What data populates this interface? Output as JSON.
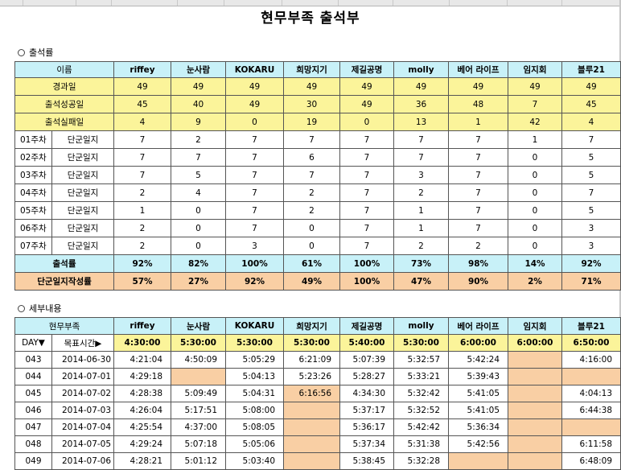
{
  "title": "현무부족 출석부",
  "summary": {
    "heading": "출석률",
    "name_label": "이름",
    "members": [
      "riffey",
      "눈사람",
      "KOKARU",
      "희망지기",
      "제길공명",
      "molly",
      "베어 라이프",
      "임지회",
      "블루21"
    ],
    "elapsed": {
      "label": "경과일",
      "values": [
        "49",
        "49",
        "49",
        "49",
        "49",
        "49",
        "49",
        "49",
        "49"
      ]
    },
    "success": {
      "label": "출석성공일",
      "values": [
        "45",
        "40",
        "49",
        "30",
        "49",
        "36",
        "48",
        "7",
        "45"
      ]
    },
    "fail": {
      "label": "출석실패일",
      "values": [
        "4",
        "9",
        "0",
        "19",
        "0",
        "13",
        "1",
        "42",
        "4"
      ]
    },
    "weeks": [
      {
        "week": "01주차",
        "label": "단군일지",
        "values": [
          "7",
          "2",
          "7",
          "7",
          "7",
          "7",
          "7",
          "1",
          "7"
        ]
      },
      {
        "week": "02주차",
        "label": "단군일지",
        "values": [
          "7",
          "7",
          "7",
          "6",
          "7",
          "7",
          "7",
          "0",
          "5"
        ]
      },
      {
        "week": "03주차",
        "label": "단군일지",
        "values": [
          "7",
          "5",
          "7",
          "7",
          "7",
          "3",
          "7",
          "0",
          "5"
        ]
      },
      {
        "week": "04주차",
        "label": "단군일지",
        "values": [
          "2",
          "4",
          "7",
          "2",
          "7",
          "2",
          "7",
          "0",
          "7"
        ]
      },
      {
        "week": "05주차",
        "label": "단군일지",
        "values": [
          "1",
          "0",
          "7",
          "2",
          "7",
          "1",
          "7",
          "0",
          "5"
        ]
      },
      {
        "week": "06주차",
        "label": "단군일지",
        "values": [
          "2",
          "0",
          "7",
          "0",
          "7",
          "1",
          "7",
          "0",
          "3"
        ]
      },
      {
        "week": "07주차",
        "label": "단군일지",
        "values": [
          "2",
          "0",
          "3",
          "0",
          "7",
          "2",
          "2",
          "0",
          "3"
        ]
      }
    ],
    "rate": {
      "label": "출석률",
      "values": [
        "92%",
        "82%",
        "100%",
        "61%",
        "100%",
        "73%",
        "98%",
        "14%",
        "92%"
      ]
    },
    "journal_rate": {
      "label": "단군일지작성률",
      "values": [
        "57%",
        "27%",
        "92%",
        "49%",
        "100%",
        "47%",
        "90%",
        "2%",
        "71%"
      ]
    }
  },
  "details": {
    "heading": "세부내용",
    "tribe_label": "현무부족",
    "day_label": "DAY▼",
    "target_label": "목표시간▶",
    "targets": [
      "4:30:00",
      "5:30:00",
      "5:30:00",
      "5:30:00",
      "5:40:00",
      "5:30:00",
      "6:00:00",
      "6:00:00",
      "6:50:00"
    ],
    "rows": [
      {
        "day": "043",
        "date": "2014-06-30",
        "times": [
          "4:21:04",
          "4:50:09",
          "5:05:29",
          "6:21:09",
          "5:07:39",
          "5:32:57",
          "5:42:24",
          "",
          "4:16:00"
        ]
      },
      {
        "day": "044",
        "date": "2014-07-01",
        "times": [
          "4:29:18",
          "",
          "5:04:13",
          "5:23:26",
          "5:28:27",
          "5:33:21",
          "5:39:43",
          "",
          ""
        ]
      },
      {
        "day": "045",
        "date": "2014-07-02",
        "times": [
          "4:28:38",
          "5:09:49",
          "5:04:31",
          "6:16:56",
          "4:34:30",
          "5:32:42",
          "5:41:05",
          "",
          "4:04:13"
        ]
      },
      {
        "day": "046",
        "date": "2014-07-03",
        "times": [
          "4:26:04",
          "5:17:51",
          "5:08:00",
          "",
          "5:37:17",
          "5:32:52",
          "5:41:05",
          "",
          "6:44:38"
        ]
      },
      {
        "day": "047",
        "date": "2014-07-04",
        "times": [
          "4:25:54",
          "4:37:00",
          "5:08:05",
          "",
          "5:36:17",
          "5:42:42",
          "5:36:34",
          "",
          ""
        ]
      },
      {
        "day": "048",
        "date": "2014-07-05",
        "times": [
          "4:29:24",
          "5:07:18",
          "5:05:06",
          "",
          "5:37:34",
          "5:31:38",
          "5:42:56",
          "",
          "6:11:58"
        ]
      },
      {
        "day": "049",
        "date": "2014-07-06",
        "times": [
          "4:28:21",
          "5:01:12",
          "5:03:40",
          "",
          "5:38:45",
          "5:32:28",
          "",
          "",
          "6:48:09"
        ]
      }
    ],
    "missed_cells": [
      [
        0,
        7
      ],
      [
        1,
        1
      ],
      [
        1,
        7
      ],
      [
        1,
        8
      ],
      [
        2,
        3
      ],
      [
        2,
        7
      ],
      [
        3,
        3
      ],
      [
        3,
        7
      ],
      [
        4,
        3
      ],
      [
        4,
        7
      ],
      [
        4,
        8
      ],
      [
        5,
        3
      ],
      [
        5,
        7
      ],
      [
        6,
        3
      ],
      [
        6,
        6
      ],
      [
        6,
        7
      ]
    ]
  },
  "colors": {
    "header": "#c8f1f8",
    "stat": "#fbf49a",
    "missed": "#f9cfa4"
  }
}
